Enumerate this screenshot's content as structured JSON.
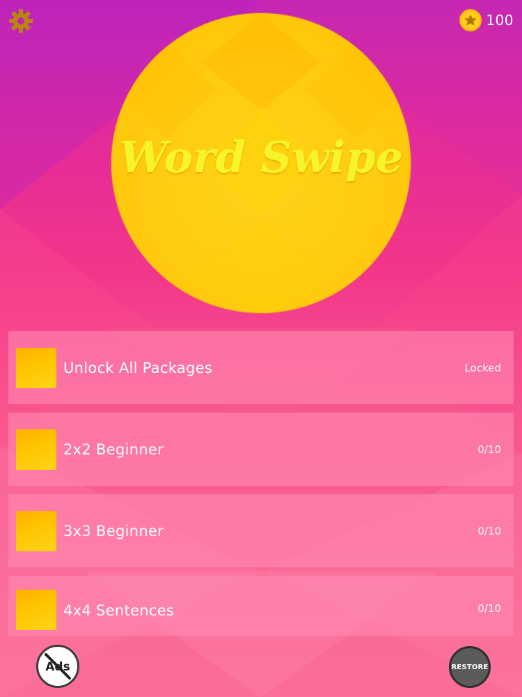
{
  "header": {
    "coins": "100",
    "settings_icon": "gear-icon",
    "coin_icon": "star-coin-icon"
  },
  "logo": {
    "title": "Word Swipe"
  },
  "packages": [
    {
      "name": "Unlock All Packages",
      "status": "Locked"
    },
    {
      "name": "2x2 Beginner",
      "status": "0/10"
    },
    {
      "name": "3x3 Beginner",
      "status": "0/10"
    },
    {
      "name": "4x4 Sentences",
      "status": "0/10"
    }
  ],
  "footer": {
    "no_ads_label": "Ads",
    "restore_label": "RESTORE"
  },
  "colors": {
    "coin": "#ffcc1a",
    "logo_circle": "#ffcb10",
    "logo_text": "#f7f52a",
    "settings_gear": "#b8860b"
  }
}
